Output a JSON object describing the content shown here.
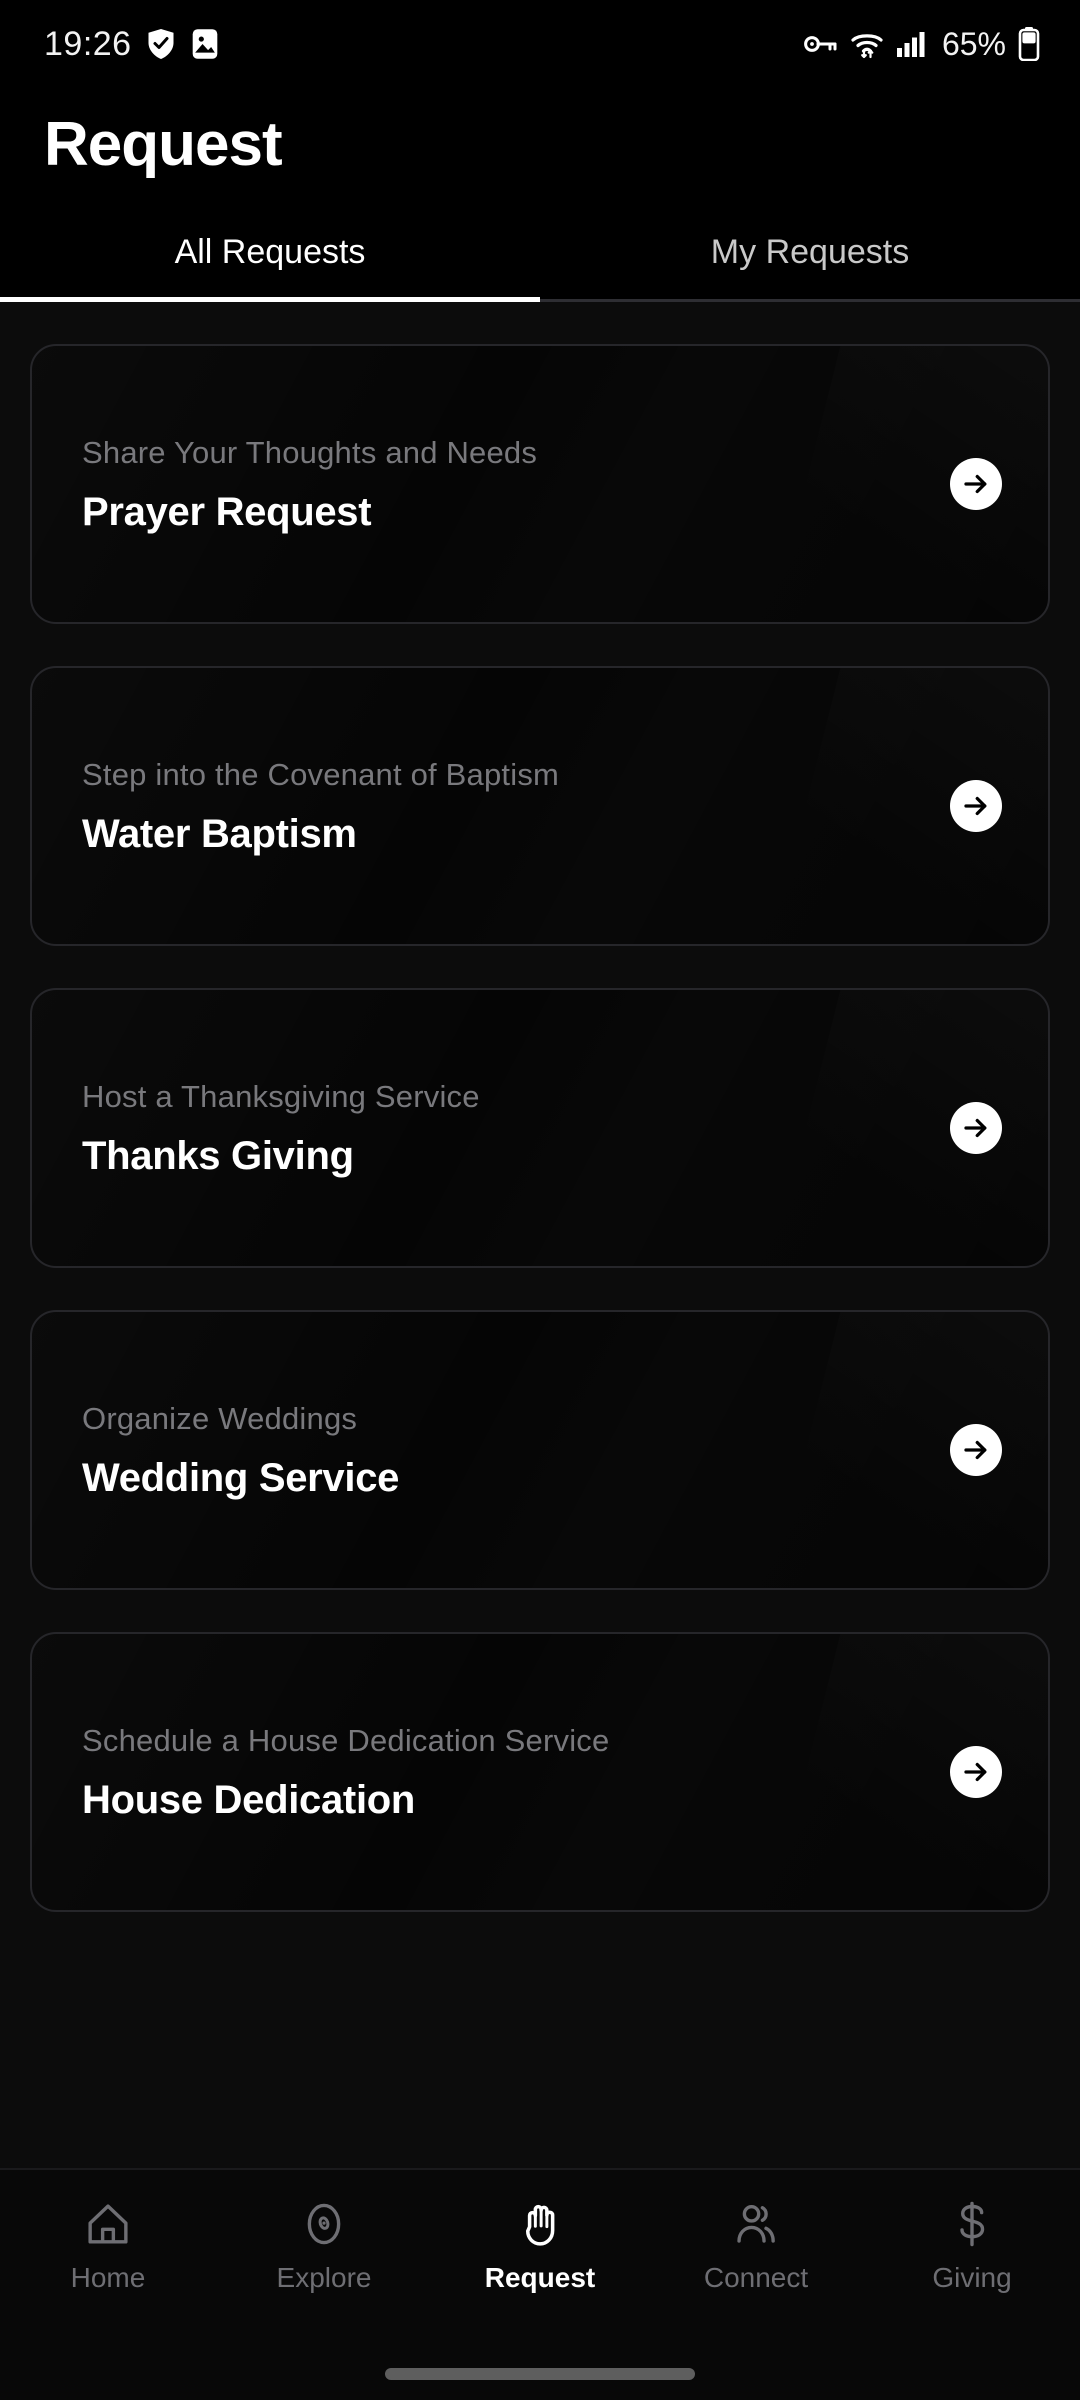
{
  "status_bar": {
    "time": "19:26",
    "battery_percent": "65%",
    "left_icons": [
      "shield-check-icon",
      "screenshot-image-icon"
    ],
    "right_icons": [
      "vpn-key-icon",
      "wifi-icon",
      "cellular-signal-icon",
      "battery-icon"
    ]
  },
  "header": {
    "title": "Request"
  },
  "tabs": {
    "items": [
      {
        "label": "All Requests",
        "active": true
      },
      {
        "label": "My Requests",
        "active": false
      }
    ]
  },
  "requests": {
    "items": [
      {
        "subtitle": "Share Your Thoughts and Needs",
        "title": "Prayer Request",
        "action": "arrow-right-icon"
      },
      {
        "subtitle": "Step into the Covenant of Baptism",
        "title": "Water Baptism",
        "action": "arrow-right-icon"
      },
      {
        "subtitle": "Host a Thanksgiving Service",
        "title": "Thanks Giving",
        "action": "arrow-right-icon"
      },
      {
        "subtitle": "Organize Weddings",
        "title": "Wedding Service",
        "action": "arrow-right-icon"
      },
      {
        "subtitle": "Schedule a House Dedication Service",
        "title": "House Dedication",
        "action": "arrow-right-icon"
      }
    ]
  },
  "bottom_nav": {
    "items": [
      {
        "label": "Home",
        "icon": "home-icon",
        "active": false
      },
      {
        "label": "Explore",
        "icon": "compass-icon",
        "active": false
      },
      {
        "label": "Request",
        "icon": "raised-hand-icon",
        "active": true
      },
      {
        "label": "Connect",
        "icon": "people-icon",
        "active": false
      },
      {
        "label": "Giving",
        "icon": "dollar-sign-icon",
        "active": false
      }
    ]
  },
  "colors": {
    "background": "#000000",
    "content_background": "#0c0c0c",
    "card_background": "#050505",
    "card_border": "#26262a",
    "accent": "#ffffff",
    "muted_text": "#79797d",
    "nav_inactive": "#6e6e73"
  }
}
